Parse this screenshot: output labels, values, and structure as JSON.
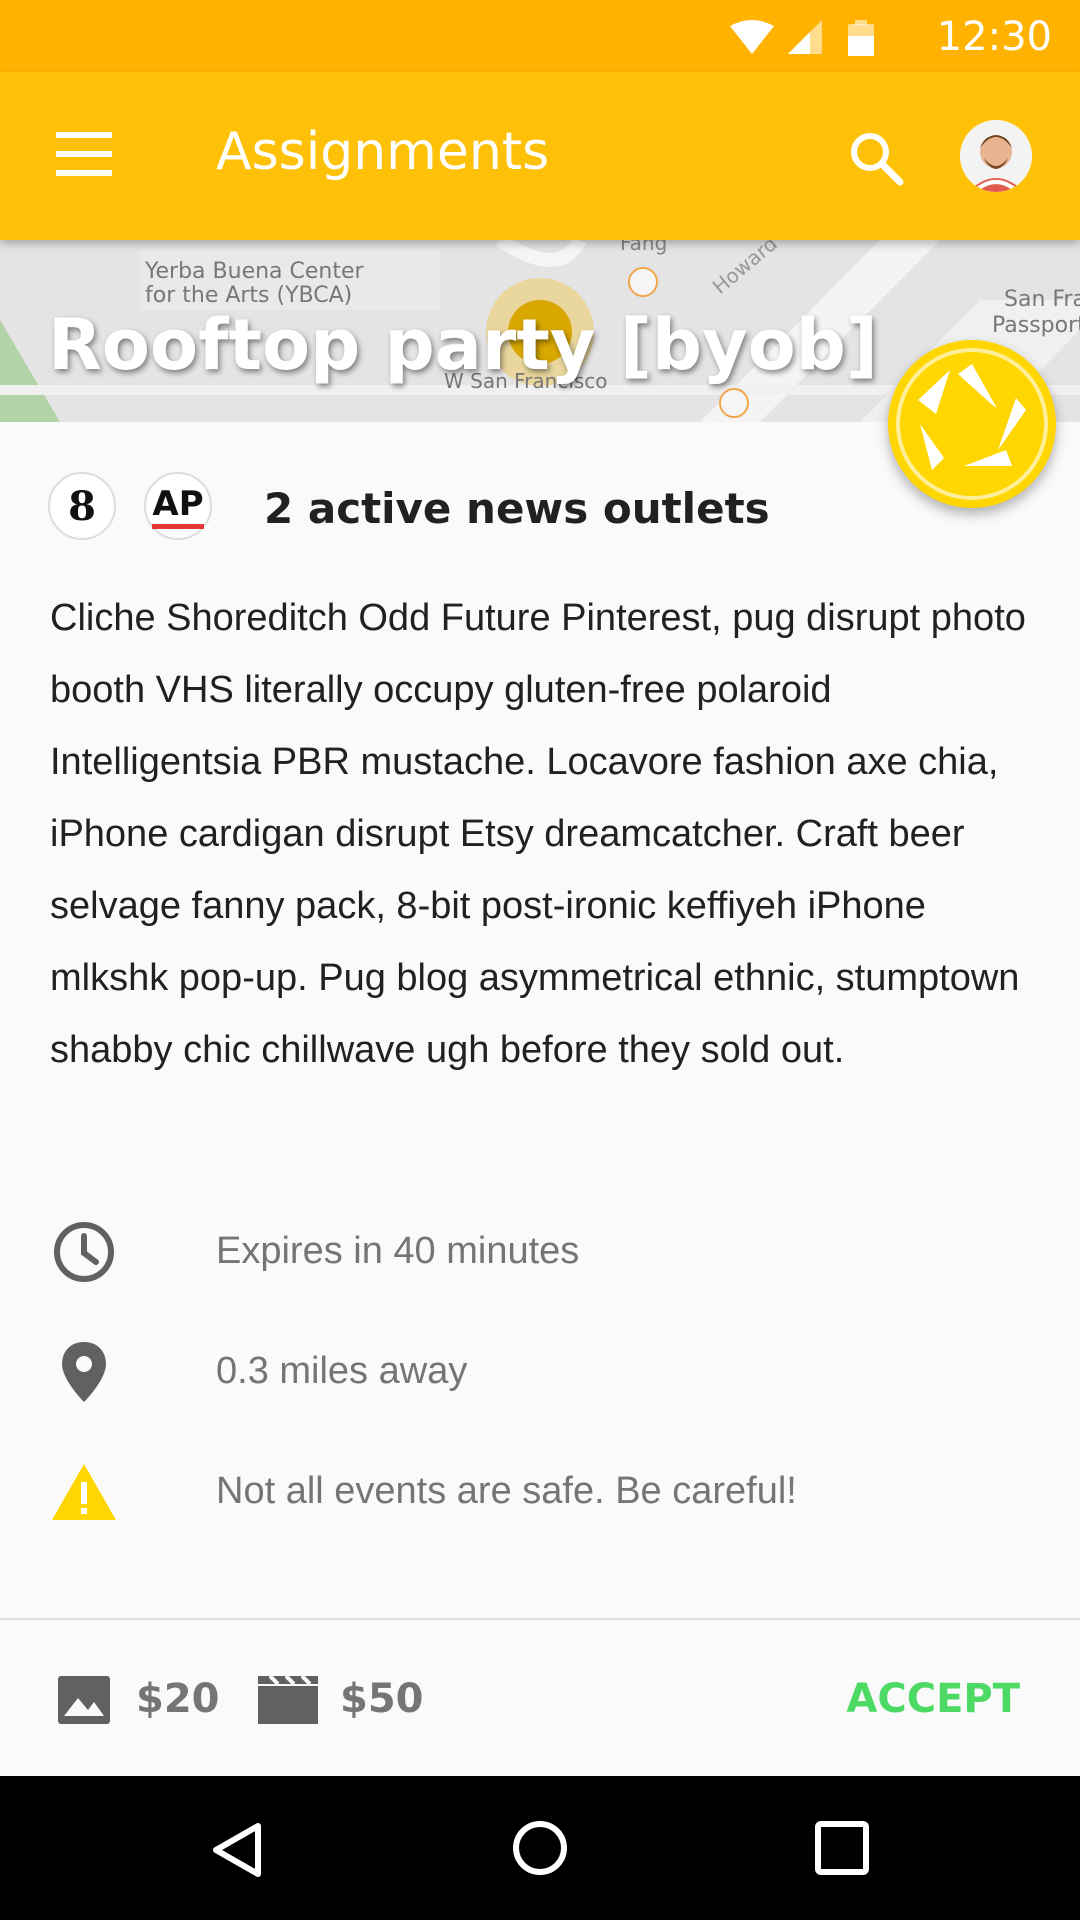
{
  "status_bar": {
    "time": "12:30"
  },
  "app_bar": {
    "title": "Assignments"
  },
  "hero": {
    "title": "Rooftop party [byob]",
    "map_labels": [
      "Yerba Buena Center",
      "for the Arts (YBCA)",
      "Fang",
      "Howard",
      "San Fra",
      "Passport",
      "W San Francisco"
    ]
  },
  "outlets": {
    "logos": [
      "8",
      "AP"
    ],
    "label": "2 active news outlets"
  },
  "description": "Cliche Shoreditch Odd Future Pinterest, pug disrupt photo booth VHS literally occupy gluten-free polaroid Intelligentsia PBR mustache. Locavore fashion axe chia, iPhone cardigan disrupt Etsy dreamcatcher. Craft beer selvage fanny pack, 8-bit post-ironic keffiyeh iPhone mlkshk pop-up. Pug blog asymmetrical ethnic, stumptown shabby chic chillwave ugh before they sold out.",
  "info": [
    {
      "icon": "clock-icon",
      "text": "Expires in 40 minutes"
    },
    {
      "icon": "location-pin-icon",
      "text": "0.3 miles away"
    },
    {
      "icon": "warning-icon",
      "text": "Not all events are safe. Be careful!"
    }
  ],
  "footer": {
    "photo_price": "$20",
    "video_price": "$50",
    "accept_label": "ACCEPT"
  },
  "colors": {
    "status_bar": "#ffb300",
    "app_bar": "#ffc107",
    "fab": "#ffd600",
    "accept": "#4cd964",
    "warning": "#ffd600"
  }
}
